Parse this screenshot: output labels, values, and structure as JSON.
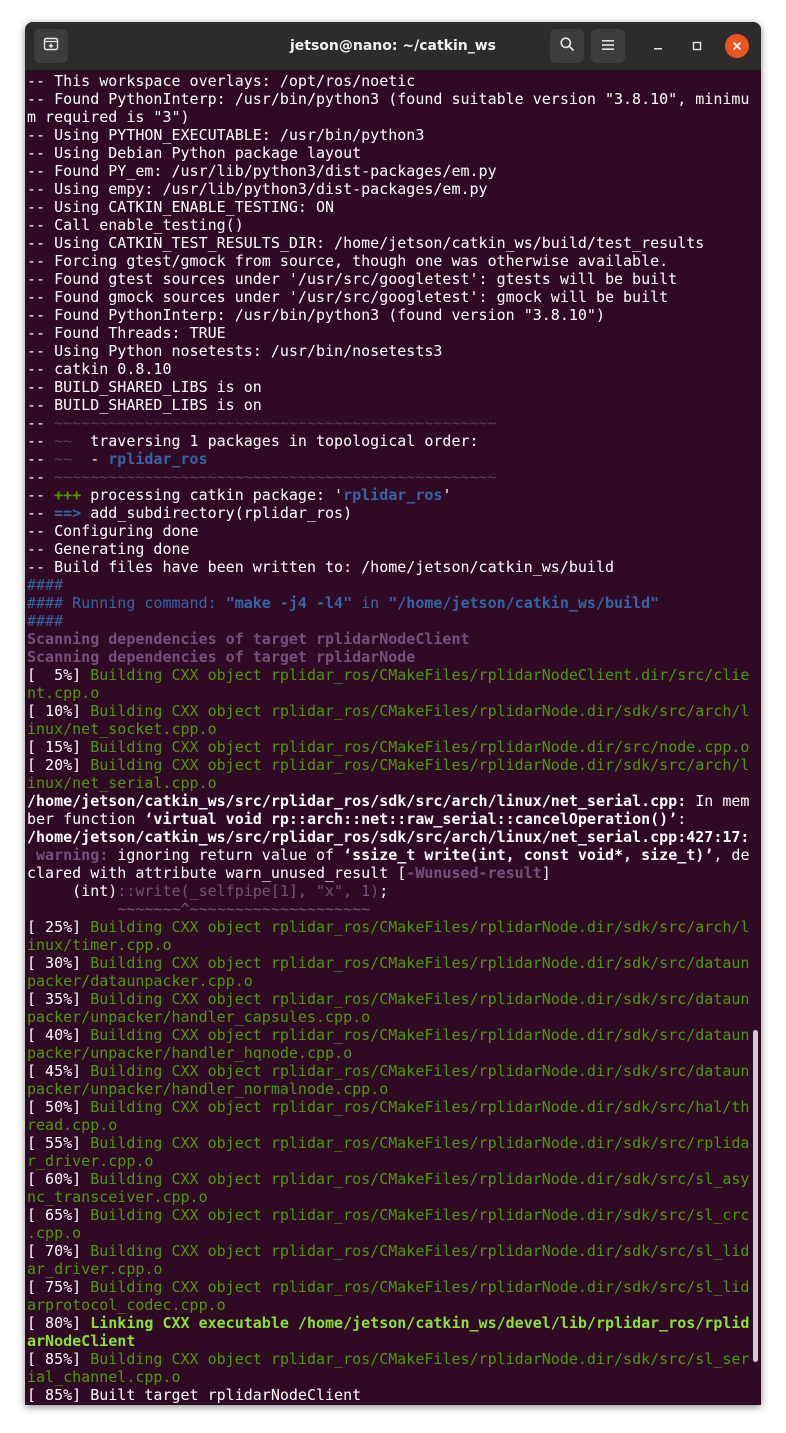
{
  "window": {
    "title": "jetson@nano: ~/catkin_ws",
    "new_tab_icon": "new-tab-icon",
    "search_icon": "search-icon",
    "menu_icon": "hamburger-menu-icon",
    "minimize_icon": "minimize-icon",
    "maximize_icon": "maximize-icon",
    "close_icon": "close-icon"
  },
  "colors": {
    "background": "#300a24",
    "text": "#ffffff",
    "green": "#4e9a06",
    "bright_green": "#8ae234",
    "blue": "#3465a4",
    "magenta": "#75507b",
    "dim": "#5c3f52",
    "close_button": "#e95420"
  },
  "terminal": {
    "lines": [
      [
        {
          "t": "-- This workspace overlays: /opt/ros/noetic"
        }
      ],
      [
        {
          "t": "-- Found PythonInterp: /usr/bin/python3 (found suitable version \"3.8.10\", minimu"
        }
      ],
      [
        {
          "t": "m required is \"3\")"
        }
      ],
      [
        {
          "t": "-- Using PYTHON_EXECUTABLE: /usr/bin/python3"
        }
      ],
      [
        {
          "t": "-- Using Debian Python package layout"
        }
      ],
      [
        {
          "t": "-- Found PY_em: /usr/lib/python3/dist-packages/em.py"
        }
      ],
      [
        {
          "t": "-- Using empy: /usr/lib/python3/dist-packages/em.py"
        }
      ],
      [
        {
          "t": "-- Using CATKIN_ENABLE_TESTING: ON"
        }
      ],
      [
        {
          "t": "-- Call enable_testing()"
        }
      ],
      [
        {
          "t": "-- Using CATKIN_TEST_RESULTS_DIR: /home/jetson/catkin_ws/build/test_results"
        }
      ],
      [
        {
          "t": "-- Forcing gtest/gmock from source, though one was otherwise available."
        }
      ],
      [
        {
          "t": "-- Found gtest sources under '/usr/src/googletest': gtests will be built"
        }
      ],
      [
        {
          "t": "-- Found gmock sources under '/usr/src/googletest': gmock will be built"
        }
      ],
      [
        {
          "t": "-- Found PythonInterp: /usr/bin/python3 (found version \"3.8.10\")"
        }
      ],
      [
        {
          "t": "-- Found Threads: TRUE"
        }
      ],
      [
        {
          "t": "-- Using Python nosetests: /usr/bin/nosetests3"
        }
      ],
      [
        {
          "t": "-- catkin 0.8.10"
        }
      ],
      [
        {
          "t": "-- BUILD_SHARED_LIBS is on"
        }
      ],
      [
        {
          "t": "-- BUILD_SHARED_LIBS is on"
        }
      ],
      [
        {
          "t": "-- "
        },
        {
          "t": "~~~~~~~~~~~~~~~~~~~~~~~~~~~~~~~~~~~~~~~~~~~~~~~~~",
          "c": "dim"
        }
      ],
      [
        {
          "t": "-- "
        },
        {
          "t": "~~",
          "c": "dim"
        },
        {
          "t": "  traversing 1 packages in topological order:"
        }
      ],
      [
        {
          "t": "-- "
        },
        {
          "t": "~~",
          "c": "dim"
        },
        {
          "t": "  - "
        },
        {
          "t": "rplidar_ros",
          "c": "blue",
          "b": true
        }
      ],
      [
        {
          "t": "-- "
        },
        {
          "t": "~~~~~~~~~~~~~~~~~~~~~~~~~~~~~~~~~~~~~~~~~~~~~~~~~",
          "c": "dim"
        }
      ],
      [
        {
          "t": "-- "
        },
        {
          "t": "+++",
          "c": "green",
          "b": true
        },
        {
          "t": " processing catkin package: '"
        },
        {
          "t": "rplidar_ros",
          "c": "blue",
          "b": true
        },
        {
          "t": "'"
        }
      ],
      [
        {
          "t": "-- "
        },
        {
          "t": "==>",
          "c": "blue",
          "b": true
        },
        {
          "t": " add_subdirectory(rplidar_ros)"
        }
      ],
      [
        {
          "t": "-- Configuring done"
        }
      ],
      [
        {
          "t": "-- Generating done"
        }
      ],
      [
        {
          "t": "-- Build files have been written to: /home/jetson/catkin_ws/build"
        }
      ],
      [
        {
          "t": "####",
          "c": "blue"
        }
      ],
      [
        {
          "t": "#### Running command: ",
          "c": "blue"
        },
        {
          "t": "\"make -j4 -l4\"",
          "c": "blue",
          "b": true
        },
        {
          "t": " in ",
          "c": "blue"
        },
        {
          "t": "\"/home/jetson/catkin_ws/build\"",
          "c": "blue",
          "b": true
        }
      ],
      [
        {
          "t": "####",
          "c": "blue"
        }
      ],
      [
        {
          "t": "Scanning dependencies of target rplidarNodeClient",
          "c": "magenta",
          "b": true
        }
      ],
      [
        {
          "t": "Scanning dependencies of target rplidarNode",
          "c": "magenta",
          "b": true
        }
      ],
      [
        {
          "t": "[  5%] "
        },
        {
          "t": "Building CXX object rplidar_ros/CMakeFiles/rplidarNodeClient.dir/src/clie",
          "c": "green"
        }
      ],
      [
        {
          "t": "nt.cpp.o",
          "c": "green"
        }
      ],
      [
        {
          "t": "[ 10%] "
        },
        {
          "t": "Building CXX object rplidar_ros/CMakeFiles/rplidarNode.dir/sdk/src/arch/l",
          "c": "green"
        }
      ],
      [
        {
          "t": "inux/net_socket.cpp.o",
          "c": "green"
        }
      ],
      [
        {
          "t": "[ 15%] "
        },
        {
          "t": "Building CXX object rplidar_ros/CMakeFiles/rplidarNode.dir/src/node.cpp.o",
          "c": "green"
        }
      ],
      [
        {
          "t": "[ 20%] "
        },
        {
          "t": "Building CXX object rplidar_ros/CMakeFiles/rplidarNode.dir/sdk/src/arch/l",
          "c": "green"
        }
      ],
      [
        {
          "t": "inux/net_serial.cpp.o",
          "c": "green"
        }
      ],
      [
        {
          "t": "/home/jetson/catkin_ws/src/rplidar_ros/sdk/src/arch/linux/net_serial.cpp:",
          "b": true
        },
        {
          "t": " In mem"
        }
      ],
      [
        {
          "t": "ber function "
        },
        {
          "t": "‘virtual void rp::arch::net::raw_serial::cancelOperation()’",
          "b": true
        },
        {
          "t": ":"
        }
      ],
      [
        {
          "t": "/home/jetson/catkin_ws/src/rplidar_ros/sdk/src/arch/linux/net_serial.cpp:427:17:",
          "b": true
        }
      ],
      [
        {
          "t": " warning: ",
          "c": "magenta",
          "b": true
        },
        {
          "t": "ignoring return value of "
        },
        {
          "t": "‘ssize_t write(int, const void*, size_t)’",
          "b": true
        },
        {
          "t": ", de"
        }
      ],
      [
        {
          "t": "clared with attribute warn_unused_result ["
        },
        {
          "t": "-Wunused-result",
          "c": "magenta",
          "b": true
        },
        {
          "t": "]"
        }
      ],
      [
        {
          "t": "     (int)"
        },
        {
          "t": "::write(_selfpipe[1], \"x\", 1)",
          "c": "magenta"
        },
        {
          "t": ";"
        }
      ],
      [
        {
          "t": "          "
        },
        {
          "t": "~~~~~~~^~~~~~~~~~~~~~~~~~~~~",
          "c": "magenta"
        }
      ],
      [
        {
          "t": "[ 25%] "
        },
        {
          "t": "Building CXX object rplidar_ros/CMakeFiles/rplidarNode.dir/sdk/src/arch/l",
          "c": "green"
        }
      ],
      [
        {
          "t": "inux/timer.cpp.o",
          "c": "green"
        }
      ],
      [
        {
          "t": "[ 30%] "
        },
        {
          "t": "Building CXX object rplidar_ros/CMakeFiles/rplidarNode.dir/sdk/src/dataun",
          "c": "green"
        }
      ],
      [
        {
          "t": "packer/dataunpacker.cpp.o",
          "c": "green"
        }
      ],
      [
        {
          "t": "[ 35%] "
        },
        {
          "t": "Building CXX object rplidar_ros/CMakeFiles/rplidarNode.dir/sdk/src/dataun",
          "c": "green"
        }
      ],
      [
        {
          "t": "packer/unpacker/handler_capsules.cpp.o",
          "c": "green"
        }
      ],
      [
        {
          "t": "[ 40%] "
        },
        {
          "t": "Building CXX object rplidar_ros/CMakeFiles/rplidarNode.dir/sdk/src/dataun",
          "c": "green"
        }
      ],
      [
        {
          "t": "packer/unpacker/handler_hqnode.cpp.o",
          "c": "green"
        }
      ],
      [
        {
          "t": "[ 45%] "
        },
        {
          "t": "Building CXX object rplidar_ros/CMakeFiles/rplidarNode.dir/sdk/src/dataun",
          "c": "green"
        }
      ],
      [
        {
          "t": "packer/unpacker/handler_normalnode.cpp.o",
          "c": "green"
        }
      ],
      [
        {
          "t": "[ 50%] "
        },
        {
          "t": "Building CXX object rplidar_ros/CMakeFiles/rplidarNode.dir/sdk/src/hal/th",
          "c": "green"
        }
      ],
      [
        {
          "t": "read.cpp.o",
          "c": "green"
        }
      ],
      [
        {
          "t": "[ 55%] "
        },
        {
          "t": "Building CXX object rplidar_ros/CMakeFiles/rplidarNode.dir/sdk/src/rplida",
          "c": "green"
        }
      ],
      [
        {
          "t": "r_driver.cpp.o",
          "c": "green"
        }
      ],
      [
        {
          "t": "[ 60%] "
        },
        {
          "t": "Building CXX object rplidar_ros/CMakeFiles/rplidarNode.dir/sdk/src/sl_asy",
          "c": "green"
        }
      ],
      [
        {
          "t": "nc_transceiver.cpp.o",
          "c": "green"
        }
      ],
      [
        {
          "t": "[ 65%] "
        },
        {
          "t": "Building CXX object rplidar_ros/CMakeFiles/rplidarNode.dir/sdk/src/sl_crc",
          "c": "green"
        }
      ],
      [
        {
          "t": ".cpp.o",
          "c": "green"
        }
      ],
      [
        {
          "t": "[ 70%] "
        },
        {
          "t": "Building CXX object rplidar_ros/CMakeFiles/rplidarNode.dir/sdk/src/sl_lid",
          "c": "green"
        }
      ],
      [
        {
          "t": "ar_driver.cpp.o",
          "c": "green"
        }
      ],
      [
        {
          "t": "[ 75%] "
        },
        {
          "t": "Building CXX object rplidar_ros/CMakeFiles/rplidarNode.dir/sdk/src/sl_lid",
          "c": "green"
        }
      ],
      [
        {
          "t": "arprotocol_codec.cpp.o",
          "c": "green"
        }
      ],
      [
        {
          "t": "[ 80%] "
        },
        {
          "t": "Linking CXX executable /home/jetson/catkin_ws/devel/lib/rplidar_ros/rplid",
          "c": "bright_green",
          "b": true
        }
      ],
      [
        {
          "t": "arNodeClient",
          "c": "bright_green",
          "b": true
        }
      ],
      [
        {
          "t": "[ 85%] "
        },
        {
          "t": "Building CXX object rplidar_ros/CMakeFiles/rplidarNode.dir/sdk/src/sl_ser",
          "c": "green"
        }
      ],
      [
        {
          "t": "ial_channel.cpp.o",
          "c": "green"
        }
      ],
      [
        {
          "t": "[ 85%] Built target rplidarNodeClient"
        }
      ]
    ]
  }
}
